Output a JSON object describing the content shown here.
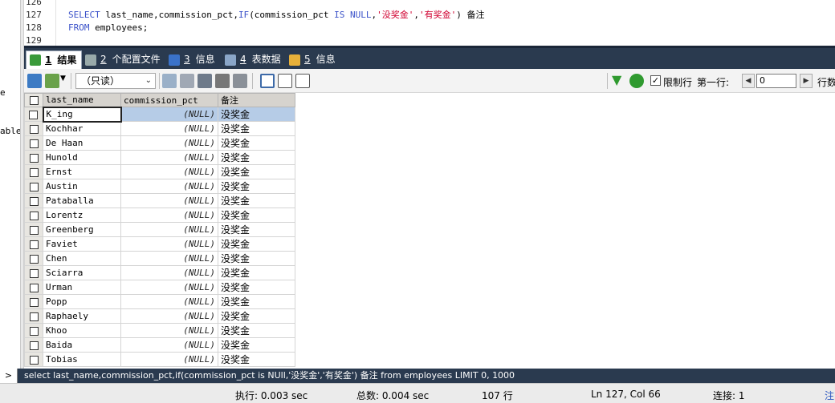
{
  "left_panel": {
    "fragments": [
      "e",
      "able"
    ]
  },
  "editor": {
    "lines": [
      {
        "number": "126",
        "parts": []
      },
      {
        "number": "127",
        "parts": [
          {
            "t": "SELECT",
            "c": "kw"
          },
          {
            "t": " last_name,commission_pct,",
            "c": "plain"
          },
          {
            "t": "IF",
            "c": "kw"
          },
          {
            "t": "(commission_pct ",
            "c": "plain"
          },
          {
            "t": "IS NULL",
            "c": "kw"
          },
          {
            "t": ",",
            "c": "plain"
          },
          {
            "t": "'没奖金'",
            "c": "str"
          },
          {
            "t": ",",
            "c": "plain"
          },
          {
            "t": "'有奖金'",
            "c": "str"
          },
          {
            "t": ") 备注",
            "c": "plain"
          }
        ]
      },
      {
        "number": "128",
        "parts": [
          {
            "t": "FROM",
            "c": "kw"
          },
          {
            "t": " employees;",
            "c": "plain"
          }
        ]
      },
      {
        "number": "129",
        "parts": []
      }
    ]
  },
  "tabs": [
    {
      "num": "1",
      "label": "结果",
      "icon": "results-grid-icon",
      "active": true,
      "color": "#3a9a3a"
    },
    {
      "num": "2",
      "label": "个配置文件",
      "icon": "profile-icon",
      "active": false,
      "color": "#9aa"
    },
    {
      "num": "3",
      "label": "信息",
      "icon": "info-icon",
      "active": false,
      "color": "#3a72c9"
    },
    {
      "num": "4",
      "label": "表数据",
      "icon": "table-data-icon",
      "active": false,
      "color": "#8aa6c8"
    },
    {
      "num": "5",
      "label": "信息",
      "icon": "info-blocks-icon",
      "active": false,
      "color": "#e8b13a"
    }
  ],
  "toolbar": {
    "mode": "（只读）",
    "limit_label": "限制行",
    "limit_checked": true,
    "first_row_label": "第一行:",
    "first_row_value": "0",
    "rows_label": "行数"
  },
  "grid": {
    "columns": [
      "last_name",
      "commission_pct",
      "备注"
    ],
    "rows": [
      [
        "K_ing",
        "(NULL)",
        "没奖金"
      ],
      [
        "Kochhar",
        "(NULL)",
        "没奖金"
      ],
      [
        "De Haan",
        "(NULL)",
        "没奖金"
      ],
      [
        "Hunold",
        "(NULL)",
        "没奖金"
      ],
      [
        "Ernst",
        "(NULL)",
        "没奖金"
      ],
      [
        "Austin",
        "(NULL)",
        "没奖金"
      ],
      [
        "Pataballa",
        "(NULL)",
        "没奖金"
      ],
      [
        "Lorentz",
        "(NULL)",
        "没奖金"
      ],
      [
        "Greenberg",
        "(NULL)",
        "没奖金"
      ],
      [
        "Faviet",
        "(NULL)",
        "没奖金"
      ],
      [
        "Chen",
        "(NULL)",
        "没奖金"
      ],
      [
        "Sciarra",
        "(NULL)",
        "没奖金"
      ],
      [
        "Urman",
        "(NULL)",
        "没奖金"
      ],
      [
        "Popp",
        "(NULL)",
        "没奖金"
      ],
      [
        "Raphaely",
        "(NULL)",
        "没奖金"
      ],
      [
        "Khoo",
        "(NULL)",
        "没奖金"
      ],
      [
        "Baida",
        "(NULL)",
        "没奖金"
      ],
      [
        "Tobias",
        "(NULL)",
        "没奖金"
      ]
    ]
  },
  "query_strip": {
    "chevron": ">",
    "text": "select last_name,commission_pct,if(commission_pct is NUll,'没奖金','有奖金') 备注 from employees LIMIT 0, 1000"
  },
  "status": {
    "exec": "执行: 0.003 sec",
    "total": "总数: 0.004 sec",
    "rows": "107 行",
    "position": "Ln 127, Col 66",
    "connection": "连接: 1",
    "note": "注"
  },
  "colors": {
    "tab_bar": "#2a3a4f",
    "selection": "#b6cce7",
    "keyword": "#3b52c9",
    "string": "#d0002f"
  }
}
